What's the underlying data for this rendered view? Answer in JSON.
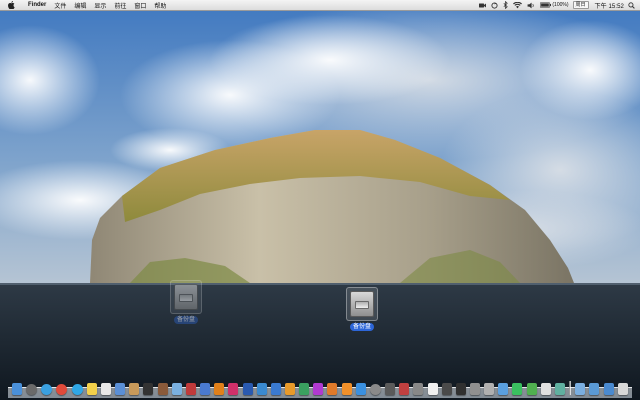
{
  "menubar": {
    "apple_icon": "apple-icon",
    "app_name": "Finder",
    "menus": [
      "文件",
      "编辑",
      "显示",
      "前往",
      "窗口",
      "帮助"
    ],
    "status": {
      "battery_percent": "(100%)",
      "user": "周日",
      "clock": "下午 15:52"
    }
  },
  "desktop": {
    "icons": [
      {
        "label": "备份盘",
        "state": "ghost"
      },
      {
        "label": "备份盘",
        "state": "selected"
      }
    ]
  },
  "dock": {
    "apps": [
      "finder-icon",
      "launchpad-icon",
      "safari-icon",
      "chrome-icon",
      "qq-icon",
      "notes-icon",
      "calendar-icon",
      "mail-icon",
      "contacts-icon",
      "terminal-icon",
      "dictionary-icon",
      "preview-icon",
      "photo-booth-icon",
      "xcode-icon",
      "illustrator-icon",
      "indesign-icon",
      "photoshop-icon",
      "network-icon",
      "keynote-icon",
      "pages-icon",
      "numbers-icon",
      "itunes-icon",
      "ibooks-icon",
      "vlc-icon",
      "app-store-icon",
      "system-preferences-icon",
      "game-icon",
      "video-icon",
      "calculator-icon",
      "textedit-icon",
      "activity-monitor-icon",
      "console-icon",
      "disk-utility-icon",
      "font-book-icon",
      "iphoto-icon",
      "messages-icon",
      "facetime-icon",
      "reminders-icon",
      "maps-icon"
    ],
    "right_items": [
      "folder-icon",
      "documents-icon",
      "downloads-icon",
      "trash-icon"
    ]
  },
  "colors": {
    "sky": "#4a7fc0",
    "cloud": "#eef2f6",
    "rock": "#b7ad94",
    "grass": "#9a8f45",
    "sea": "#1a2632",
    "selection": "#2d66d8"
  }
}
